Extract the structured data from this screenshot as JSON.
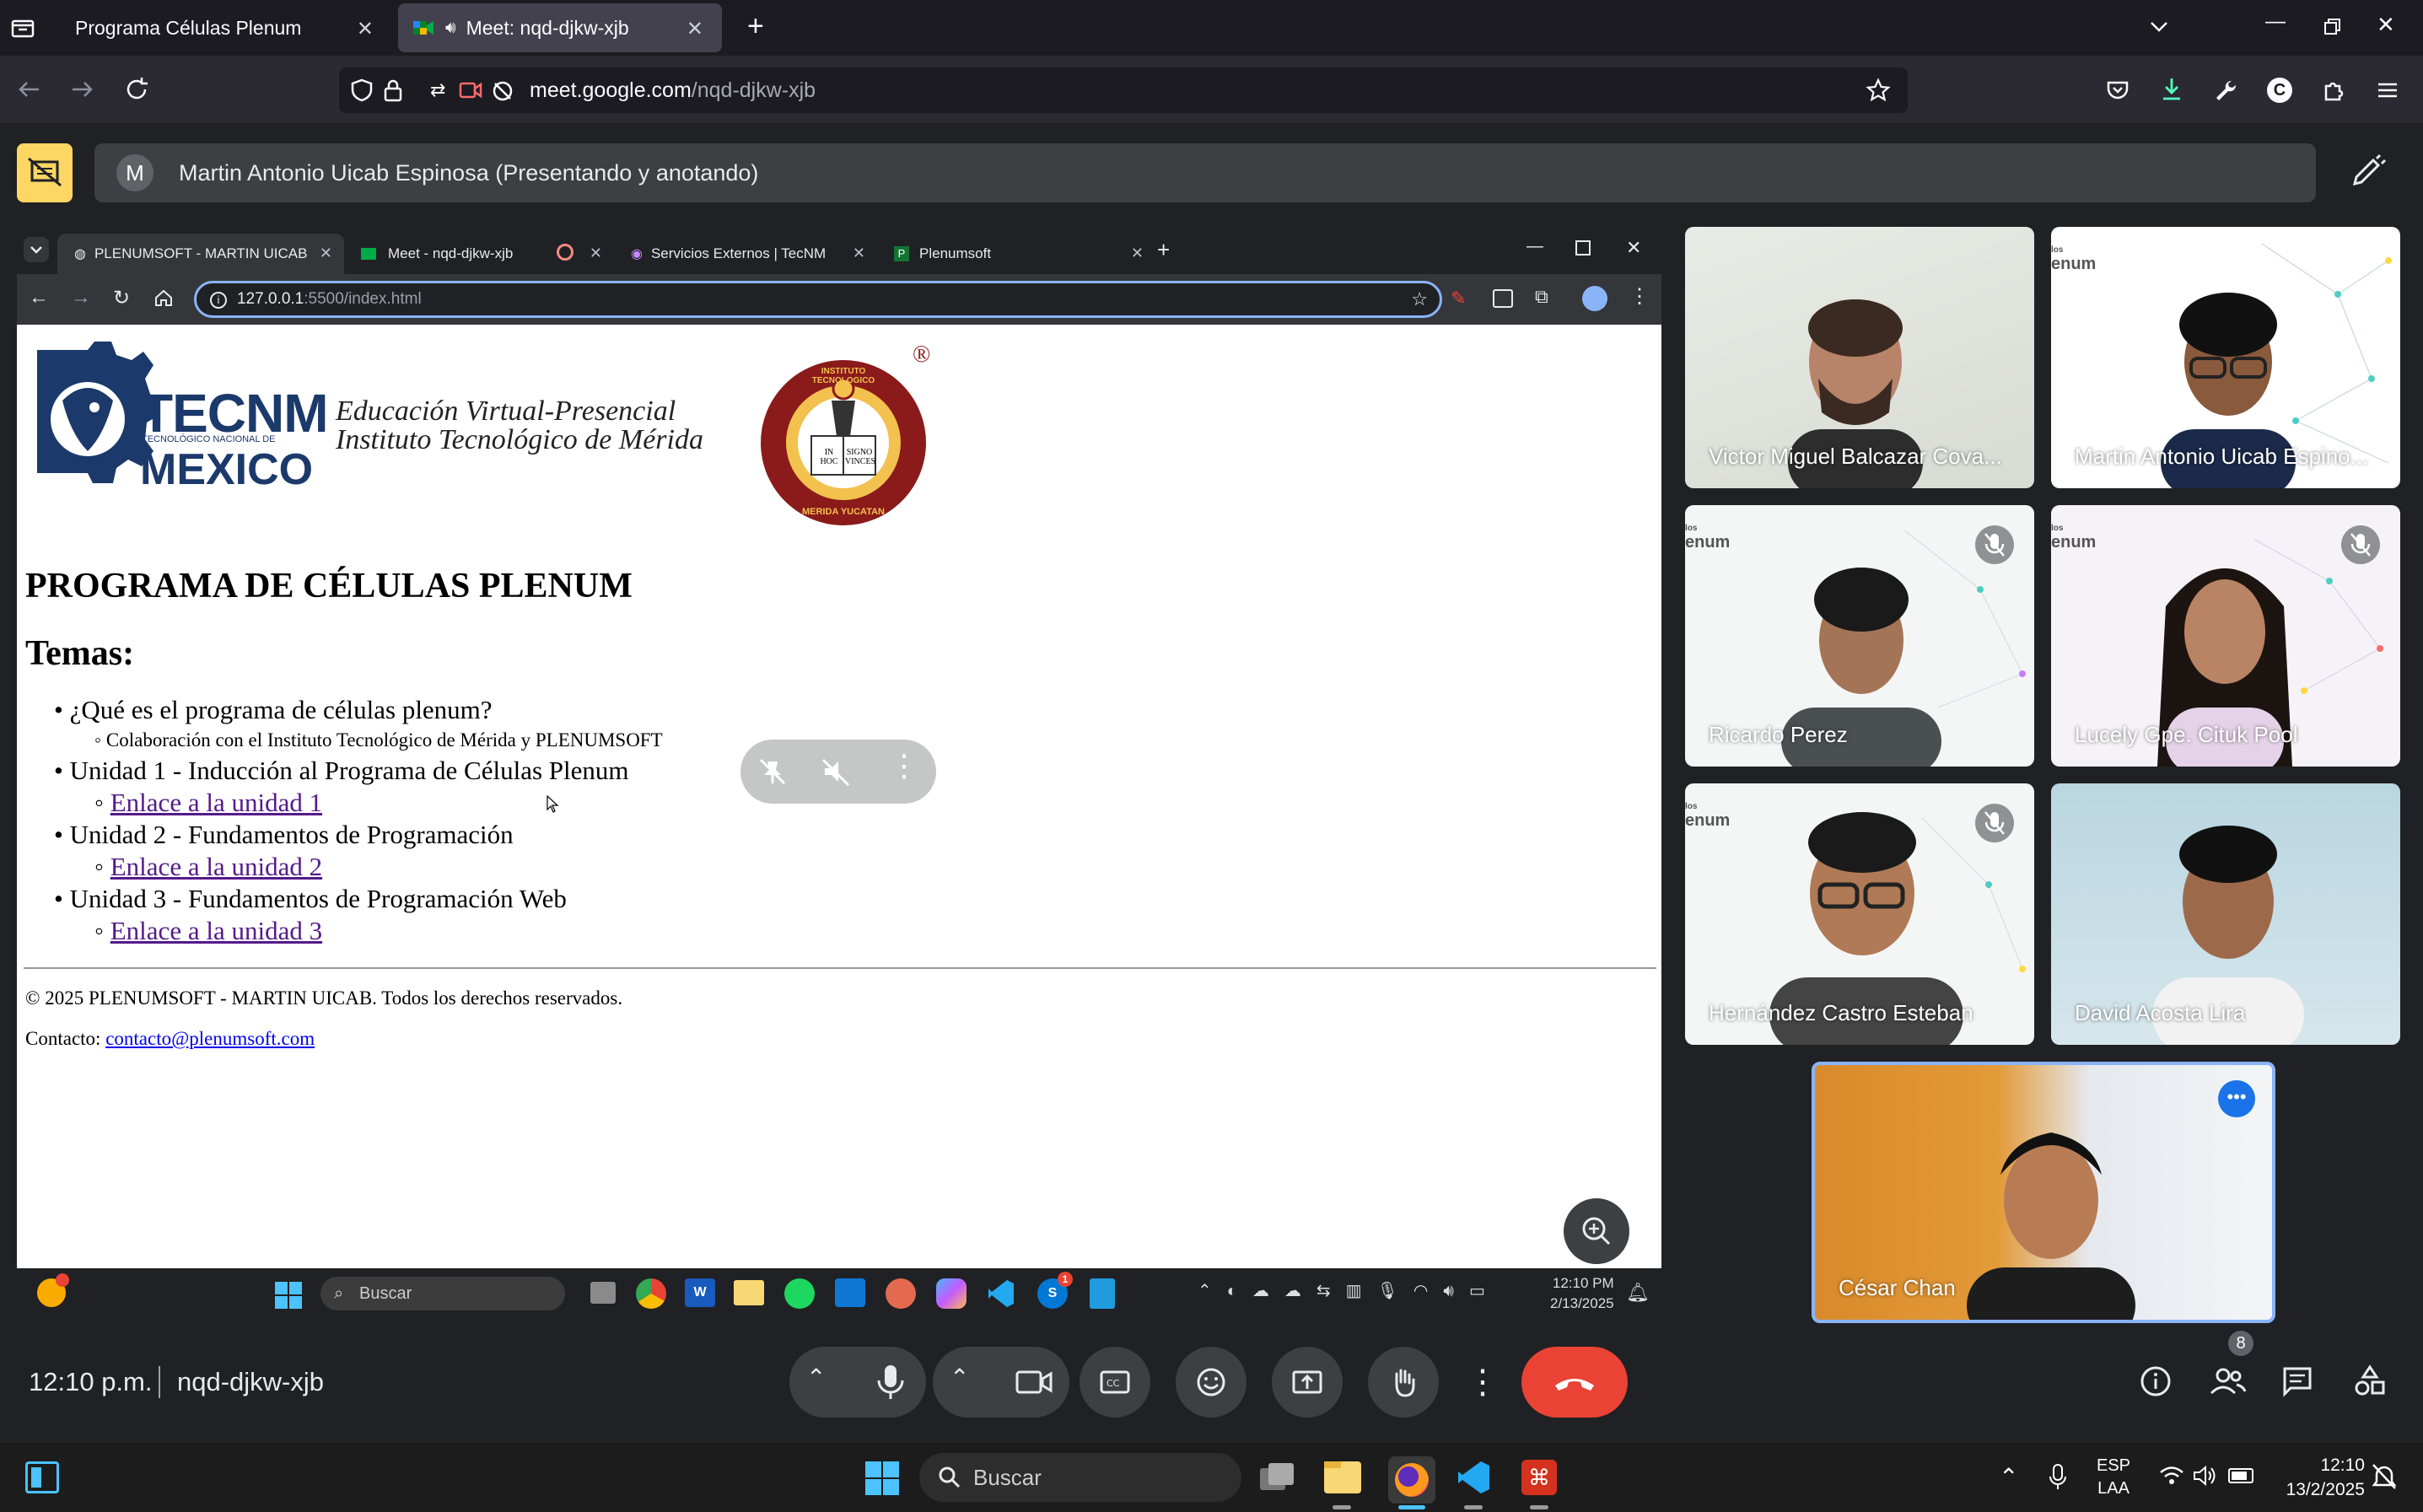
{
  "firefox": {
    "tabs": [
      {
        "title": "Programa Células Plenum",
        "active": false
      },
      {
        "title": "Meet: nqd-djkw-xjb",
        "active": true
      }
    ],
    "url_host": "meet.google.com",
    "url_path": "/nqd-djkw-xjb"
  },
  "meet": {
    "presenter_initial": "M",
    "presenter_label": "Martin Antonio Uicab Espinosa (Presentando y anotando)",
    "time": "12:10 p.m.",
    "meeting_code": "nqd-djkw-xjb",
    "participant_count": "8",
    "participants": [
      {
        "name": "Victor Miguel Balcazar Cova...",
        "muted": false
      },
      {
        "name": "Martin Antonio Uicab Espino...",
        "muted": false
      },
      {
        "name": "Ricardo Perez",
        "muted": true
      },
      {
        "name": "Lucely Gpe. Cituk Pool",
        "muted": true
      },
      {
        "name": "Hernández Castro Esteban",
        "muted": true
      },
      {
        "name": "David Acosta Lira",
        "muted": false
      },
      {
        "name": "César Chan",
        "muted": false
      }
    ],
    "tile_logo_text": "enum",
    "tile_logo_prefix": "los"
  },
  "shared": {
    "tabs": [
      {
        "title": "PLENUMSOFT - MARTIN UICAB"
      },
      {
        "title": "Meet - nqd-djkw-xjb"
      },
      {
        "title": "Servicios Externos | TecNM"
      },
      {
        "title": "Plenumsoft"
      }
    ],
    "url_host": "127.0.0.1",
    "url_rest": ":5500/index.html",
    "page": {
      "tecnm_big": "TECNM",
      "tecnm_small": "TECNOLÓGICO NACIONAL DE",
      "tecnm_country": "MEXICO",
      "subtitle_1": "Educación Virtual-Presencial",
      "subtitle_2": "Instituto Tecnológico de Mérida",
      "seal_text_top": "INSTITUTO TECNOLOGICO",
      "seal_text_bottom": "MERIDA YUCATAN",
      "seal_book_left": "IN HOC",
      "seal_book_right": "SIGNO VINCES",
      "registered": "®",
      "heading": "PROGRAMA DE CÉLULAS PLENUM",
      "temas": "Temas:",
      "items": [
        {
          "text": "¿Qué es el programa de células plenum?",
          "sub": "Colaboración con el Instituto Tecnológico de Mérida y PLENUMSOFT",
          "sub_is_link": false
        },
        {
          "text": "Unidad 1 - Inducción al Programa de Células Plenum",
          "sub": "Enlace a la unidad 1",
          "sub_is_link": true
        },
        {
          "text": "Unidad 2 - Fundamentos de Programación",
          "sub": "Enlace a la unidad 2",
          "sub_is_link": true
        },
        {
          "text": "Unidad 3 - Fundamentos de Programación Web",
          "sub": "Enlace a la unidad 3",
          "sub_is_link": true
        }
      ],
      "footer_copy": "© 2025 PLENUMSOFT - MARTIN UICAB. Todos los derechos reservados.",
      "contact_label": "Contacto:",
      "contact_email": "contacto@plenumsoft.com"
    },
    "taskbar": {
      "search": "Buscar",
      "time": "12:10 PM",
      "date": "2/13/2025",
      "spotify_badge": "1"
    }
  },
  "os_taskbar": {
    "search": "Buscar",
    "lang_1": "ESP",
    "lang_2": "LAA",
    "time": "12:10",
    "date": "13/2/2025"
  },
  "colors": {
    "meet_bg": "#202124",
    "end_call": "#ea4335",
    "link": "#551a8b",
    "tecnm_blue": "#1b396a",
    "highlight": "#8ab4f8"
  }
}
